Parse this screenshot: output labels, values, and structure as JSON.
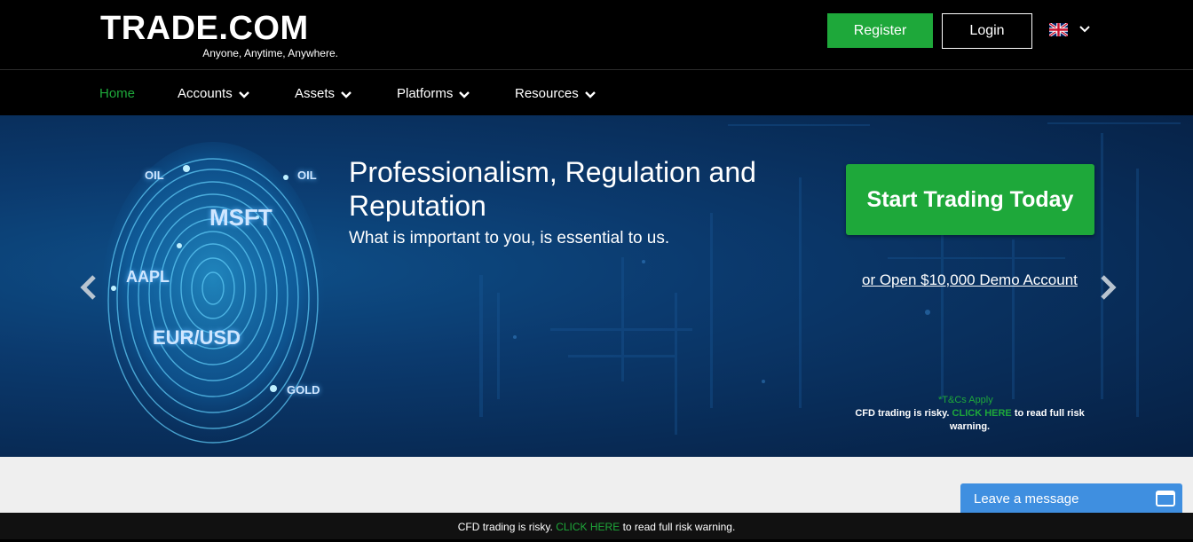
{
  "header": {
    "logo_text": "TRADE.COM",
    "tagline": "Anyone, Anytime, Anywhere.",
    "register_label": "Register",
    "login_label": "Login",
    "language_icon": "uk-flag-icon"
  },
  "nav": {
    "items": [
      {
        "label": "Home",
        "active": true
      },
      {
        "label": "Accounts"
      },
      {
        "label": "Assets"
      },
      {
        "label": "Platforms"
      },
      {
        "label": "Resources"
      }
    ]
  },
  "hero": {
    "tags": [
      "OIL",
      "OIL",
      "MSFT",
      "AAPL",
      "EUR/USD",
      "GOLD"
    ],
    "title": "Professionalism, Regulation and Reputation",
    "subtitle": "What is important to you, is essential to us.",
    "cta_label": "Start Trading Today",
    "demo_link": "or Open $10,000 Demo Account",
    "tcs": "*T&Cs Apply",
    "risk_prefix": "CFD trading is risky.",
    "risk_link": "CLICK HERE",
    "risk_suffix": "to read full risk warning."
  },
  "chat": {
    "label": "Leave a message"
  },
  "risk_bar": {
    "prefix": "CFD trading is risky.",
    "link": "CLICK HERE",
    "suffix": "to read full risk warning."
  },
  "colors": {
    "brand_green": "#1ea83a",
    "hero_blue": "#0b3a6e",
    "chat_blue": "#3f8fe0"
  }
}
